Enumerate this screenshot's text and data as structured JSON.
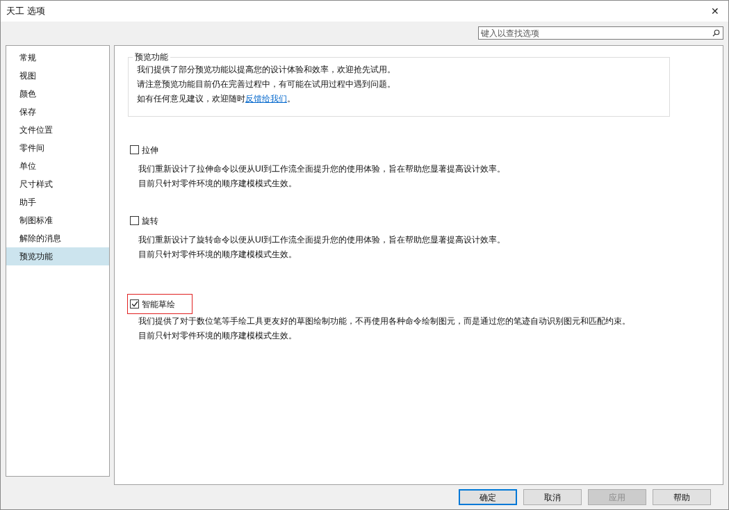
{
  "window": {
    "title": "天工 选项",
    "close": "✕"
  },
  "search": {
    "placeholder": "键入以查找选项"
  },
  "sidebar": {
    "items": [
      {
        "label": "常规",
        "selected": false
      },
      {
        "label": "视图",
        "selected": false
      },
      {
        "label": "颜色",
        "selected": false
      },
      {
        "label": "保存",
        "selected": false
      },
      {
        "label": "文件位置",
        "selected": false
      },
      {
        "label": "零件间",
        "selected": false
      },
      {
        "label": "单位",
        "selected": false
      },
      {
        "label": "尺寸样式",
        "selected": false
      },
      {
        "label": "助手",
        "selected": false
      },
      {
        "label": "制图标准",
        "selected": false
      },
      {
        "label": "解除的消息",
        "selected": false
      },
      {
        "label": "预览功能",
        "selected": true
      }
    ]
  },
  "intro": {
    "legend": "预览功能",
    "lines": [
      "我们提供了部分预览功能以提高您的设计体验和效率，欢迎抢先试用。",
      "请注意预览功能目前仍在完善过程中，有可能在试用过程中遇到问题。"
    ],
    "last_line": {
      "text": "如有任何意见建议，欢迎随时",
      "link": "反馈给我们",
      "suffix": "。"
    }
  },
  "features": [
    {
      "label": "拉伸",
      "checked": false,
      "highlighted": false,
      "description": [
        "我们重新设计了拉伸命令以便从UI到工作流全面提升您的使用体验，旨在帮助您显著提高设计效率。",
        "目前只针对零件环境的顺序建模模式生效。"
      ]
    },
    {
      "label": "旋转",
      "checked": false,
      "highlighted": false,
      "description": [
        "我们重新设计了旋转命令以便从UI到工作流全面提升您的使用体验，旨在帮助您显著提高设计效率。",
        "目前只针对零件环境的顺序建模模式生效。"
      ]
    },
    {
      "label": "智能草绘",
      "checked": true,
      "highlighted": true,
      "description": [
        "我们提供了对于数位笔等手绘工具更友好的草图绘制功能，不再使用各种命令绘制图元，而是通过您的笔迹自动识别图元和匹配约束。",
        "目前只针对零件环境的顺序建模模式生效。"
      ]
    }
  ],
  "buttons": [
    {
      "label": "确定",
      "default": true,
      "disabled": false
    },
    {
      "label": "取消",
      "default": false,
      "disabled": false
    },
    {
      "label": "应用",
      "default": false,
      "disabled": true
    },
    {
      "label": "帮助",
      "default": false,
      "disabled": false
    }
  ]
}
